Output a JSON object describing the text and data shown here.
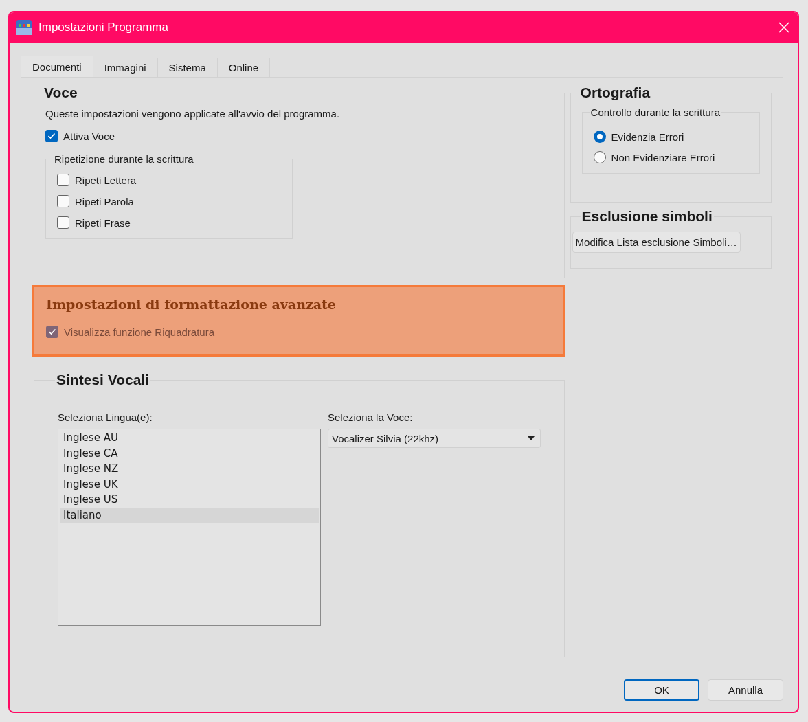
{
  "window": {
    "title": "Impostazioni Programma"
  },
  "tabs": [
    {
      "label": "Documenti",
      "selected": true
    },
    {
      "label": "Immagini",
      "selected": false
    },
    {
      "label": "Sistema",
      "selected": false
    },
    {
      "label": "Online",
      "selected": false
    }
  ],
  "voice": {
    "title": "Voce",
    "description": "Queste impostazioni vengono applicate all'avvio del programma.",
    "enable": {
      "label": "Attiva Voce",
      "checked": true
    },
    "repeat_group": {
      "title": "Ripetizione durante la scrittura",
      "options": [
        {
          "label": "Ripeti Lettera",
          "checked": false
        },
        {
          "label": "Ripeti Parola",
          "checked": false
        },
        {
          "label": "Ripeti Frase",
          "checked": false
        }
      ]
    }
  },
  "advanced_formatting": {
    "title": "Impostazioni di formattazione avanzate",
    "highlighted": true,
    "option": {
      "label": "Visualizza funzione Riquadratura",
      "checked": true
    }
  },
  "speech_synthesis": {
    "title": "Sintesi Vocali",
    "languages_label": "Seleziona Lingua(e):",
    "languages": [
      {
        "label": "Inglese AU",
        "selected": false
      },
      {
        "label": "Inglese CA",
        "selected": false
      },
      {
        "label": "Inglese NZ",
        "selected": false
      },
      {
        "label": "Inglese UK",
        "selected": false
      },
      {
        "label": "Inglese US",
        "selected": false
      },
      {
        "label": "Italiano",
        "selected": true
      }
    ],
    "voice_label": "Seleziona la Voce:",
    "voice_value": "Vocalizer Silvia (22khz)"
  },
  "spelling": {
    "title": "Ortografia",
    "group_title": "Controllo durante la scrittura",
    "options": [
      {
        "label": "Evidenzia Errori",
        "selected": true
      },
      {
        "label": "Non Evidenziare Errori",
        "selected": false
      }
    ]
  },
  "symbol_exclusion": {
    "title": "Esclusione simboli",
    "button": "Modifica Lista esclusione Simboli…"
  },
  "buttons": [
    {
      "label": "OK",
      "default": true
    },
    {
      "label": "Annulla",
      "default": false
    }
  ]
}
